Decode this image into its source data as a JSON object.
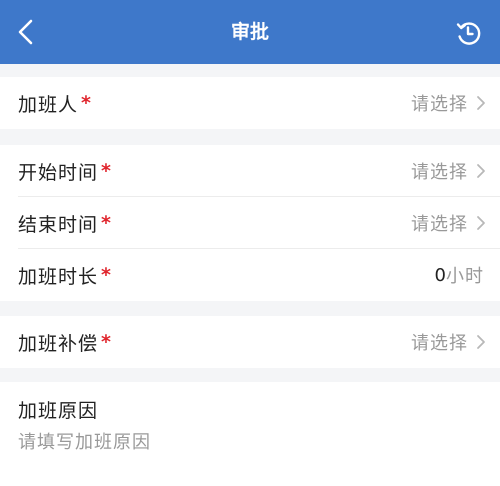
{
  "header": {
    "title": "审批",
    "back_icon": "chevron-left-icon",
    "history_icon": "history-clock-icon"
  },
  "form": {
    "overtime_person": {
      "label": "加班人",
      "required_mark": "*",
      "placeholder": "请选择"
    },
    "start_time": {
      "label": "开始时间",
      "required_mark": "*",
      "placeholder": "请选择"
    },
    "end_time": {
      "label": "结束时间",
      "required_mark": "*",
      "placeholder": "请选择"
    },
    "duration": {
      "label": "加班时长",
      "required_mark": "*",
      "value": "0",
      "unit": "小时"
    },
    "compensation": {
      "label": "加班补偿",
      "required_mark": "*",
      "placeholder": "请选择"
    },
    "reason": {
      "label": "加班原因",
      "placeholder": "请填写加班原因"
    }
  },
  "colors": {
    "header_bg": "#3e78ca",
    "required": "#e0242c",
    "placeholder": "#999999"
  }
}
